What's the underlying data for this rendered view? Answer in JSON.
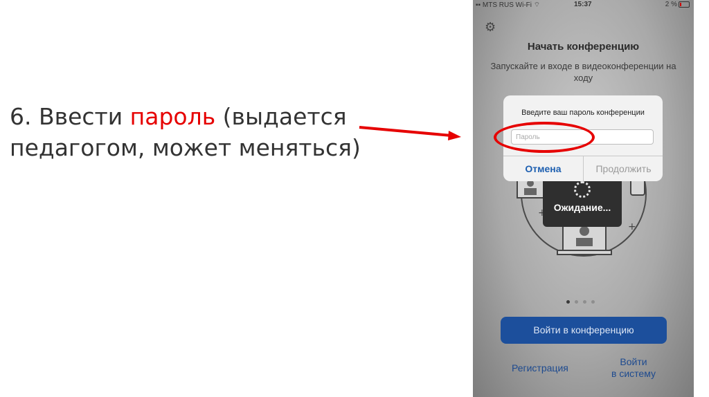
{
  "slide": {
    "step_prefix": "6. Ввести ",
    "step_highlight": "пароль",
    "step_suffix": " (выдается педагогом, может меняться)"
  },
  "status_bar": {
    "carrier": "MTS RUS Wi-Fi",
    "time": "15:37",
    "battery": "2 %"
  },
  "screen": {
    "title": "Начать конференцию",
    "subtitle": "Запускайте и входе в видеоконференции на ходу",
    "waiting_label": "Ожидание...",
    "join_button": "Войти в конференцию",
    "register_link": "Регистрация",
    "signin_link_line1": "Войти",
    "signin_link_line2": "в систему"
  },
  "dialog": {
    "title": "Введите ваш пароль конференции",
    "input_placeholder": "Пароль",
    "input_value": "",
    "cancel_label": "Отмена",
    "continue_label": "Продолжить"
  },
  "pager": {
    "count": 4,
    "active_index": 0
  },
  "colors": {
    "accent_red": "#e60000",
    "primary_blue": "#1c4f9c",
    "link_blue": "#1d5fb0"
  },
  "icons": [
    "gear-icon",
    "wifi-icon",
    "battery-icon",
    "spinner-icon",
    "arrow-annotation",
    "highlight-ellipse"
  ]
}
